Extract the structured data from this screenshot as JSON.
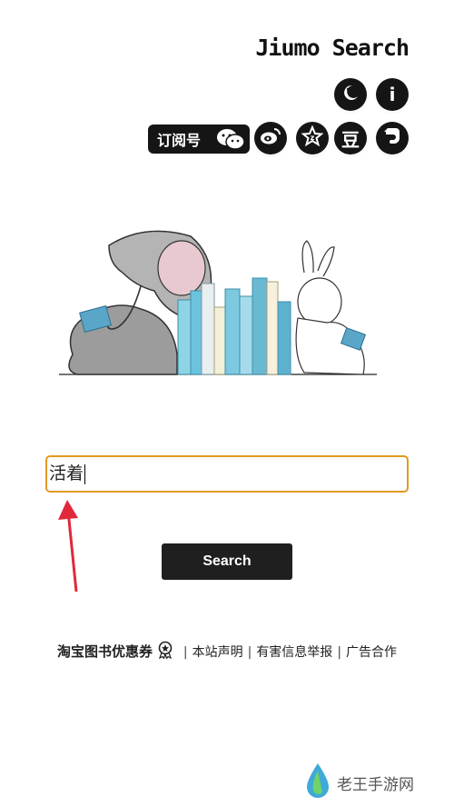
{
  "header": {
    "brand": "Jiumo Search",
    "subscribe_label": "订阅号"
  },
  "icons": {
    "night_mode": "moon-icon",
    "info": "info-icon",
    "wechat": "wechat-icon",
    "weibo": "weibo-icon",
    "star": "star-icon",
    "douban": "douban-icon",
    "evernote": "evernote-icon",
    "douban_char": "豆",
    "info_char": "i"
  },
  "search": {
    "value": "活着",
    "button_label": "Search"
  },
  "footer": {
    "coupon": "淘宝图书优惠券",
    "about": "本站声明",
    "report": "有害信息举报",
    "ads": "广告合作",
    "separator": "|"
  },
  "watermark": {
    "text": "老王手游网"
  },
  "colors": {
    "input_border": "#e09a1f",
    "button_bg": "#1f1f1f",
    "arrow": "#e0283a"
  }
}
